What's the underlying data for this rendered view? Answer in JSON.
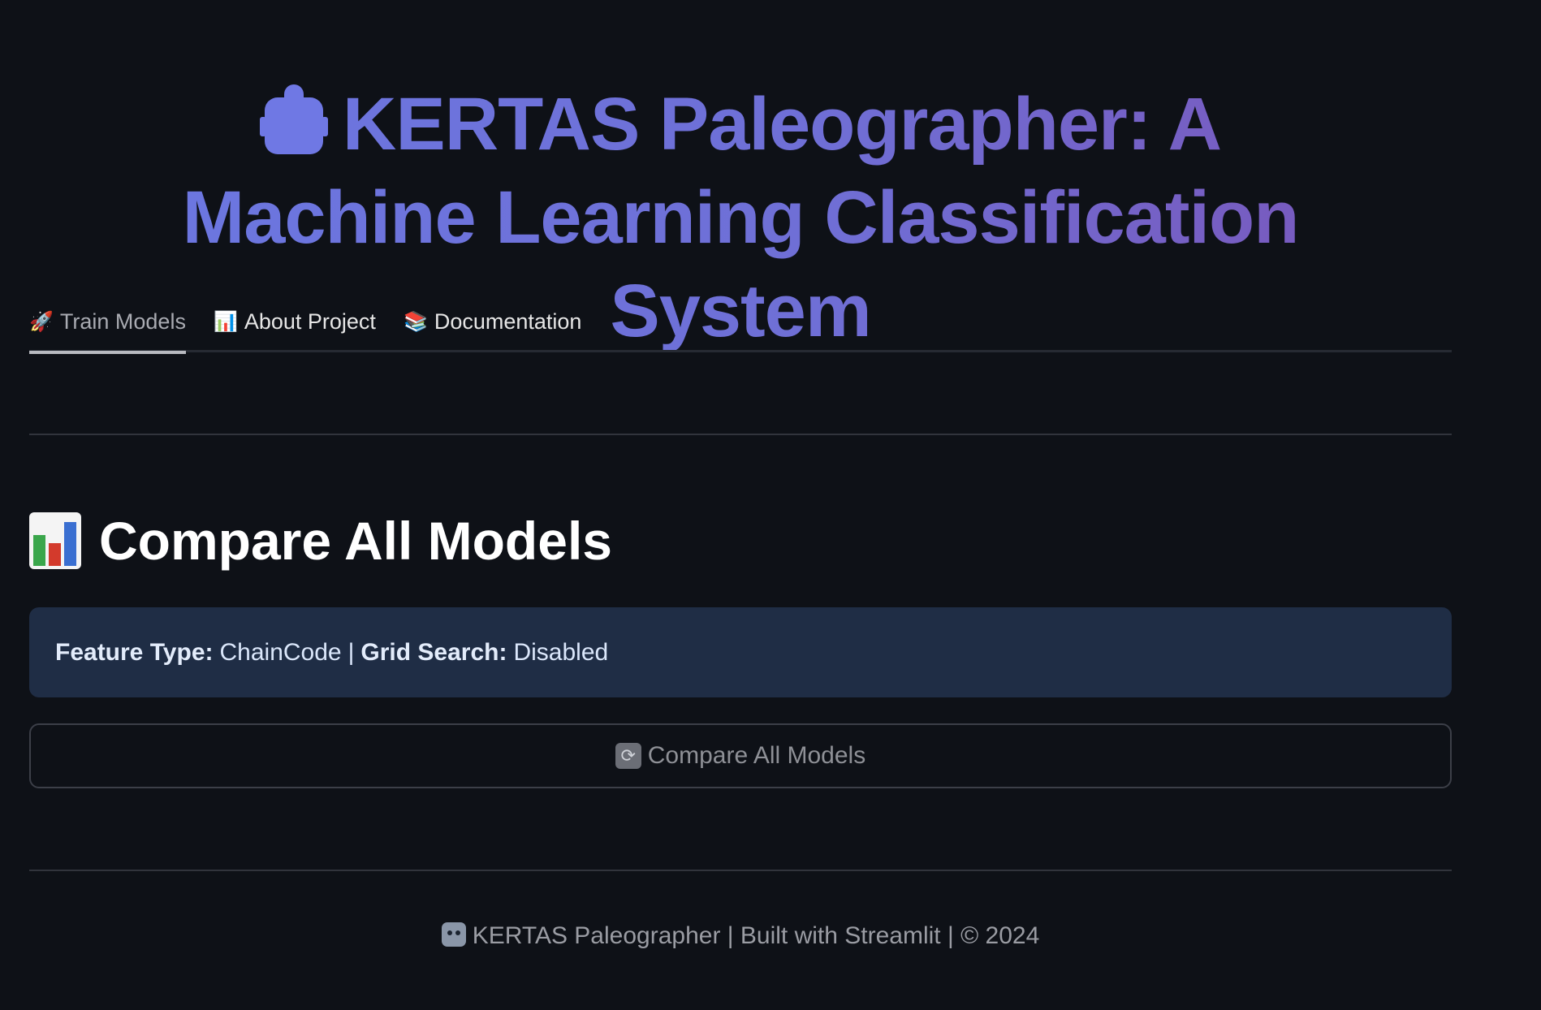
{
  "header": {
    "title": "KERTAS Paleographer: A Machine Learning Classification System",
    "title_icon": "robot-icon",
    "gradient_colors": [
      "#6b78e2",
      "#7a55b8"
    ]
  },
  "tabs": [
    {
      "icon": "🚀",
      "label": "Train Models",
      "active": true
    },
    {
      "icon": "📊",
      "label": "About Project",
      "active": false
    },
    {
      "icon": "📚",
      "label": "Documentation",
      "active": false
    }
  ],
  "section": {
    "title": "Compare All Models",
    "icon": "bar-chart-icon"
  },
  "info": {
    "feature_type_label": "Feature Type:",
    "feature_type_value": "ChainCode",
    "separator": "|",
    "grid_search_label": "Grid Search:",
    "grid_search_value": "Disabled"
  },
  "compare_button": {
    "icon": "refresh-icon",
    "label": "Compare All Models"
  },
  "footer": {
    "text": "KERTAS Paleographer | Built with Streamlit | © 2024",
    "icon": "robot-icon"
  },
  "colors": {
    "background": "#0e1117",
    "info_bg": "#1f2d45",
    "accent": "#6b78e2"
  }
}
